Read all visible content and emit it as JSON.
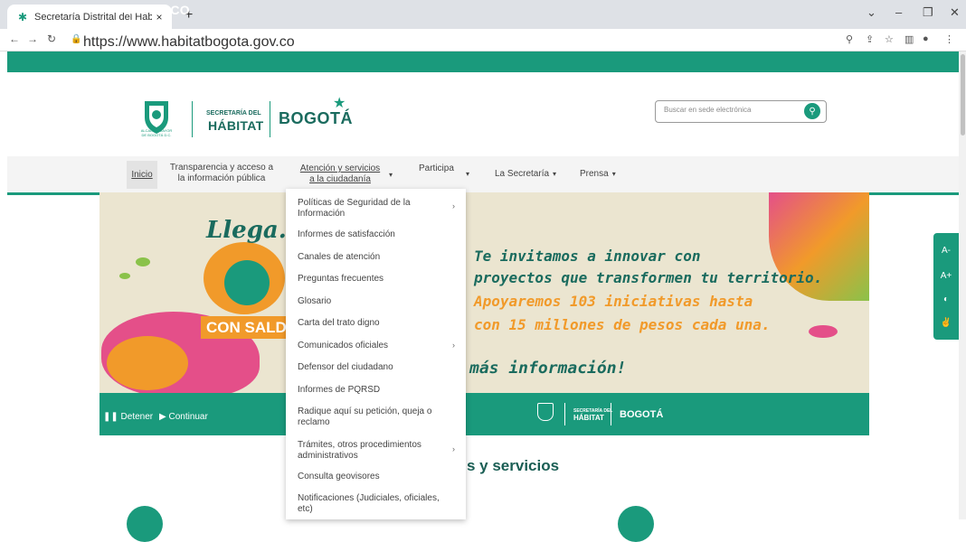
{
  "browser": {
    "tab_title": "Secretaría Distrital del Hábitat | H",
    "tab_close": "×",
    "new_tab": "+",
    "url": "https://www.habitatbogota.gov.co"
  },
  "gov": {
    "logo": "⚙'GOV.CO"
  },
  "header": {
    "alcaldia": "ALCALDÍA MAYOR DE BOGOTÁ D.C.",
    "secretaria_small": "SECRETARÍA DEL",
    "secretaria_big": "HÁBITAT",
    "bogota": "BOGOTÁ",
    "search_placeholder": "Buscar en sede electrónica"
  },
  "nav": {
    "inicio": "Inicio",
    "transparencia_1": "Transparencia y acceso a",
    "transparencia_2": "la información pública",
    "atencion_1": "Atención y servicios",
    "atencion_2": "a la ciudadanía",
    "participa": "Participa",
    "secretaria": "La Secretaría",
    "prensa": "Prensa"
  },
  "dropdown": [
    {
      "label_1": "Políticas de Seguridad de la",
      "label_2": "Información",
      "has_sub": true
    },
    {
      "label_1": "Informes de satisfacción"
    },
    {
      "label_1": "Canales de atención"
    },
    {
      "label_1": "Preguntas frecuentes"
    },
    {
      "label_1": "Glosario"
    },
    {
      "label_1": "Carta del trato digno"
    },
    {
      "label_1": "Comunicados oficiales",
      "has_sub": true
    },
    {
      "label_1": "Defensor del ciudadano"
    },
    {
      "label_1": "Informes de PQRSD"
    },
    {
      "label_1": "Radique aquí su petición, queja o",
      "label_2": "reclamo"
    },
    {
      "label_1": "Trámites, otros procedimientos",
      "label_2": "administrativos",
      "has_sub": true
    },
    {
      "label_1": "Consulta geovisores"
    },
    {
      "label_1": "Notificaciones (Judiciales, oficiales,",
      "label_2": "etc)"
    }
  ],
  "banner": {
    "llega": "Llega...",
    "consal": "CON SALD",
    "line1": "Te invitamos a innovar con",
    "line2": "proyectos que transformen tu territorio.",
    "line3": "Apoyaremos 103 iniciativas hasta",
    "line4": "con 15 millones de pesos cada una.",
    "mas": "más información!"
  },
  "slider": {
    "detener": "Detener",
    "continuar": "Continuar",
    "sec": "SECRETARÍA DEL",
    "hab": "HÁBITAT",
    "bog": "BOGOTÁ"
  },
  "section": {
    "title": "s y servicios"
  },
  "a11y": {
    "minus": "A-",
    "plus": "A+",
    "contrast": "◐",
    "sign": "✌"
  },
  "colors": {
    "brand": "#1a9a7c",
    "dark": "#1a6b5e",
    "orange": "#f19a2a",
    "pink": "#e44f89"
  }
}
